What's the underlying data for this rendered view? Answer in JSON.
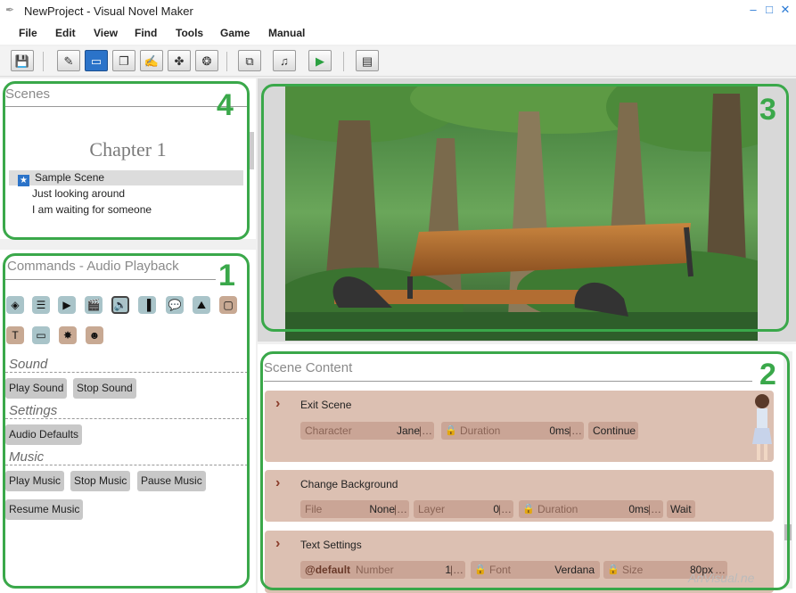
{
  "window": {
    "title": "NewProject - Visual Novel Maker",
    "minimize": "–",
    "maximize": "□",
    "close": "✕"
  },
  "menu": [
    "File",
    "Edit",
    "View",
    "Find",
    "Tools",
    "Game",
    "Manual"
  ],
  "toolbar": {
    "buttons": [
      {
        "name": "save-button",
        "glyph": "💾"
      },
      {
        "name": "edit-mode-button",
        "glyph": "✎"
      },
      {
        "name": "scene-view-button",
        "glyph": "▭"
      },
      {
        "name": "database-button",
        "glyph": "❐"
      },
      {
        "name": "script-button",
        "glyph": "✍"
      },
      {
        "name": "plugin-button",
        "glyph": "✤"
      },
      {
        "name": "layers-button",
        "glyph": "❂"
      },
      {
        "name": "copy-button",
        "glyph": "⧉"
      },
      {
        "name": "music-button",
        "glyph": "♫"
      },
      {
        "name": "play-button",
        "glyph": "▶"
      },
      {
        "name": "book-button",
        "glyph": "▤"
      }
    ]
  },
  "scenes_panel": {
    "title": "Scenes",
    "chapter": "Chapter 1",
    "items": [
      {
        "label": "Sample Scene",
        "selected": true
      },
      {
        "label": "Just looking around"
      },
      {
        "label": "I am waiting for someone"
      }
    ],
    "badge": "4"
  },
  "commands_panel": {
    "title": "Commands - Audio Playback",
    "badge": "1",
    "icons_row1": [
      "◈",
      "☰",
      "▶",
      "🎬",
      "🔊",
      "▐",
      "💬",
      "⛰",
      "▢"
    ],
    "icons_row2": [
      "T",
      "▭",
      "✸",
      "☻"
    ],
    "categories": [
      {
        "label": "Sound",
        "buttons": [
          "Play Sound",
          "Stop Sound"
        ]
      },
      {
        "label": "Settings",
        "buttons": [
          "Audio Defaults"
        ]
      },
      {
        "label": "Music",
        "buttons": [
          "Play Music",
          "Stop Music",
          "Pause Music",
          "Resume Music"
        ]
      }
    ]
  },
  "preview": {
    "badge": "3"
  },
  "scene_content": {
    "title": "Scene Content",
    "badge": "2",
    "items": [
      {
        "name": "Exit Scene",
        "fields": [
          {
            "label": "Character",
            "value": "Jane"
          },
          {
            "label": "Duration",
            "value": "0ms",
            "locked": true
          },
          {
            "label": "Continue",
            "button": true
          }
        ]
      },
      {
        "name": "Change Background",
        "fields": [
          {
            "label": "File",
            "value": "None"
          },
          {
            "label": "Layer",
            "value": "0"
          },
          {
            "label": "Duration",
            "value": "0ms",
            "locked": true
          },
          {
            "label": "Wait",
            "button": true
          }
        ]
      },
      {
        "name": "Text Settings",
        "fields": [
          {
            "label": "@default",
            "value": "",
            "bold": true
          },
          {
            "label": "Number",
            "value": "1"
          },
          {
            "label": "Font",
            "value": "Verdana",
            "locked": true
          },
          {
            "label": "Size",
            "value": "80px",
            "locked": true
          }
        ]
      }
    ]
  },
  "watermark": "AnVisual.ne"
}
